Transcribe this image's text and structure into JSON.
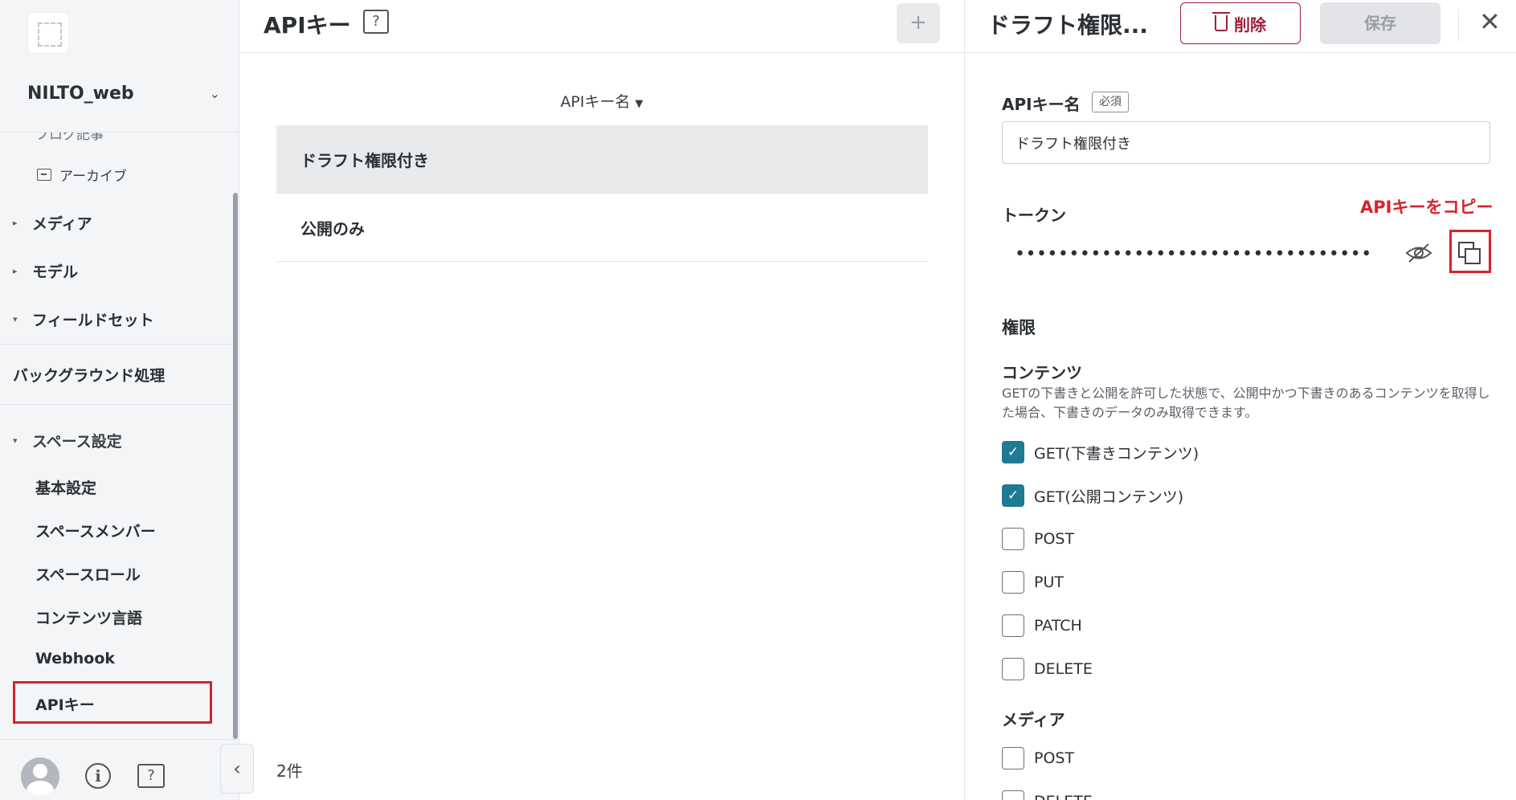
{
  "sidebar": {
    "space_name": "NILTO_web",
    "partial_item": "ブログ記事",
    "archive_label": "アーカイブ",
    "media_label": "メディア",
    "model_label": "モデル",
    "fieldset_label": "フィールドセット",
    "background_label": "バックグラウンド処理",
    "space_settings_label": "スペース設定",
    "settings_items": [
      "基本設定",
      "スペースメンバー",
      "スペースロール",
      "コンテンツ言語",
      "Webhook",
      "APIキー"
    ],
    "selected_item": "APIキー"
  },
  "list": {
    "title": "APIキー",
    "add_label": "+",
    "column_header": "APIキー名",
    "rows": [
      "ドラフト権限付き",
      "公開のみ"
    ],
    "count": "2件"
  },
  "panel": {
    "title": "ドラフト権限...",
    "delete_label": "削除",
    "save_label": "保存",
    "name_label": "APIキー名",
    "required_badge": "必須",
    "name_value": "ドラフト権限付き",
    "token_label": "トークン",
    "token_masked": "•••••••••••••••••••••••••••••••••",
    "copy_annotation": "APIキーをコピー",
    "permissions_label": "権限",
    "contents_label": "コンテンツ",
    "contents_help": "GETの下書きと公開を許可した状態で、公開中かつ下書きのあるコンテンツを取得した場合、下書きのデータのみ取得できます。",
    "contents_permissions": [
      {
        "label": "GET(下書きコンテンツ)",
        "checked": true
      },
      {
        "label": "GET(公開コンテンツ)",
        "checked": true
      },
      {
        "label": "POST",
        "checked": false
      },
      {
        "label": "PUT",
        "checked": false
      },
      {
        "label": "PATCH",
        "checked": false
      },
      {
        "label": "DELETE",
        "checked": false
      }
    ],
    "media_label": "メディア",
    "media_permissions": [
      {
        "label": "POST",
        "checked": false
      },
      {
        "label": "DELETE",
        "checked": false
      }
    ]
  },
  "colors": {
    "highlight": "#d8222c",
    "checkbox_checked": "#1f7a94",
    "delete": "#9e1f3a"
  },
  "icons": [
    "logo-icon",
    "chevron-down-icon",
    "archive-icon",
    "caret-right-icon",
    "caret-down-icon",
    "avatar-icon",
    "info-icon",
    "help-icon",
    "chevron-left-icon",
    "plus-icon",
    "sort-caret-icon",
    "trash-icon",
    "close-icon",
    "eye-off-icon",
    "copy-icon",
    "check-icon"
  ]
}
